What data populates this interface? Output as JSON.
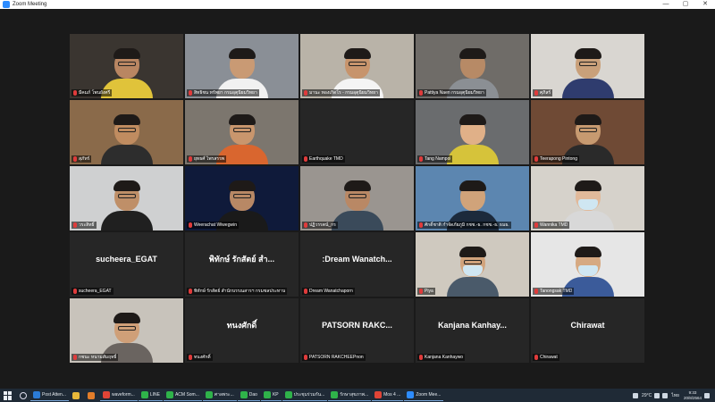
{
  "window": {
    "title": "Zoom Meeting",
    "controls": [
      "—",
      "▢",
      "✕"
    ]
  },
  "participants": [
    {
      "name": "มีคมภ์ โพนยังศรี",
      "video": true,
      "bg": "#3a3530",
      "skin": "#b98662",
      "shirt": "#e0c33a",
      "glasses": true
    },
    {
      "name": "สิทธิชน ทรัพยา กรมอุตุนิยมวิทยา",
      "video": true,
      "bg": "#8a8f96",
      "skin": "#c99a74",
      "shirt": "#f1f1f1",
      "active": true
    },
    {
      "name": "มานะ ทองเกิดโร - กรมอุตุนิยมวิทยา",
      "video": true,
      "bg": "#b9b3a8",
      "skin": "#c7946c",
      "shirt": "#f4f4f4",
      "glasses": true
    },
    {
      "name": "Pattiya Naen กรมอุตุนิยมวิทยา",
      "video": true,
      "bg": "#6f6c68",
      "skin": "#b78a66",
      "shirt": "#8b8f94"
    },
    {
      "name": "ศุภิสร์",
      "video": true,
      "bg": "#d9d6d1",
      "skin": "#c9a07a",
      "shirt": "#2f3c6e",
      "glasses": true
    },
    {
      "name": "สุภัทร์",
      "video": true,
      "bg": "#8a6a4a",
      "skin": "#c08c60",
      "shirt": "#2d2d2d",
      "glasses": true
    },
    {
      "name": "ยุทธศ์ ไพรสรรพ",
      "video": true,
      "bg": "#7c766e",
      "skin": "#c9966d",
      "shirt": "#d9662f",
      "glasses": true
    },
    {
      "name": "Earthquake TMD",
      "video": false,
      "display": ""
    },
    {
      "name": "Tang Nampol",
      "video": true,
      "bg": "#6a6c6e",
      "skin": "#e0b088",
      "shirt": "#d6c33a"
    },
    {
      "name": "Teerapong Pintong",
      "video": true,
      "bg": "#6f4a35",
      "skin": "#c79a70",
      "shirt": "#2a2a2a",
      "glasses": true
    },
    {
      "name": "วระสิทธิ์",
      "video": true,
      "bg": "#cfd0d1",
      "skin": "#bf8f68",
      "shirt": "#202020",
      "glasses": true
    },
    {
      "name": "Weerachat Wiwegwin",
      "video": true,
      "bg": "#0f1a3a",
      "skin": "#b88865",
      "shirt": "#1a1a1a",
      "glasses": true
    },
    {
      "name": "ปฏิวรรตน์_กร",
      "video": true,
      "bg": "#9a9590",
      "skin": "#b98865",
      "shirt": "#3a4a5a",
      "glasses": true
    },
    {
      "name": "ศักดิ์ชาติ กำจัดภัยภูมิ กชช.-ธ. กชช.-ธ. ธมธ.",
      "video": true,
      "bg": "#5c86b0",
      "skin": "#d0a37a",
      "shirt": "#1c2a3c"
    },
    {
      "name": "Wannika TMD",
      "video": true,
      "bg": "#d6d2cb",
      "skin": "#e1b99a",
      "shirt": "#d8d8d8",
      "mask": true
    },
    {
      "name": "sucheera_EGAT",
      "video": false,
      "display": "sucheera_EGAT"
    },
    {
      "name": "พิทักษ์ รักสัตย์ สำนักบรรณสารฯ กรมชลประทาน",
      "video": false,
      "display": "พิทักษ์ รักสัตย์ สำ..."
    },
    {
      "name": "Dream Wanatchaporn",
      "video": false,
      "display": ":Dream Wanatch..."
    },
    {
      "name": "Piya",
      "video": true,
      "bg": "#cfc9bf",
      "skin": "#d1a37c",
      "shirt": "#4a5a6a",
      "glasses": true,
      "mask": true
    },
    {
      "name": "Tanongsak TMD",
      "video": true,
      "bg": "#e6e6e6",
      "skin": "#d6a982",
      "shirt": "#3b5b9a",
      "mask": true
    },
    {
      "name": "กชนะ หนามสัมฤทธิ์",
      "video": true,
      "bg": "#c8c3bb",
      "skin": "#cf9f78",
      "shirt": "#6a6460",
      "glasses": true
    },
    {
      "name": "ทนงศักดิ์",
      "video": false,
      "display": "ทนงศักดิ์"
    },
    {
      "name": "PATSORN RAKCHEEPnon",
      "video": false,
      "display": "PATSORN RAKC..."
    },
    {
      "name": "Kanjana Kanhaywo",
      "video": false,
      "display": "Kanjana Kanhay..."
    },
    {
      "name": "Chirawat",
      "video": false,
      "display": "Chirawat"
    }
  ],
  "taskbar": {
    "apps": [
      {
        "label": "Post Atten...",
        "color": "#2b7bd6"
      },
      {
        "label": "",
        "color": "#e7b83a"
      },
      {
        "label": "",
        "color": "#e27d2a"
      },
      {
        "label": "waveform...",
        "color": "#e04436"
      },
      {
        "label": "LINE",
        "color": "#2fb24a"
      },
      {
        "label": "ACM Som...",
        "color": "#2fb24a"
      },
      {
        "label": "ศาลพระ...",
        "color": "#2fb24a"
      },
      {
        "label": "Dao",
        "color": "#2fb24a"
      },
      {
        "label": "KP",
        "color": "#2fb24a"
      },
      {
        "label": "ประชุมร่วมกัน...",
        "color": "#2fb24a"
      },
      {
        "label": "รักษาสุขภาพ...",
        "color": "#2fb24a"
      },
      {
        "label": "Mos 4 ...",
        "color": "#e04436"
      },
      {
        "label": "Zoom Mee...",
        "color": "#2d8cff"
      }
    ],
    "weather": "29°C",
    "language": "ไทย",
    "time": "9:33",
    "date": "20/8/2564"
  }
}
